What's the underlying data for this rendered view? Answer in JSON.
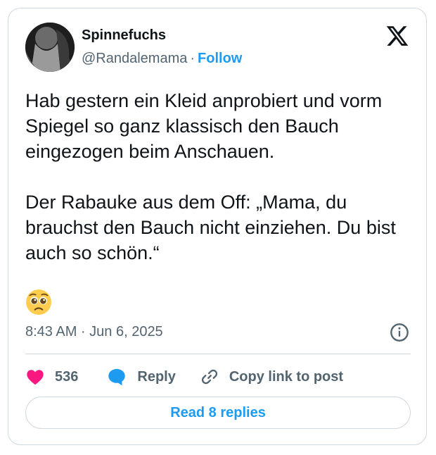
{
  "author": {
    "name": "Spinnefuchs",
    "handle": "@Randalemama",
    "separator": "·",
    "follow_label": "Follow"
  },
  "brand": {
    "logo_icon": "x-logo-icon"
  },
  "post": {
    "paragraphs": [
      "Hab gestern ein Kleid anprobiert und vorm Spiegel so ganz klassisch den Bauch eingezogen beim Anschauen.",
      "Der Rabauke aus dem Off: „Mama, du brauchst den Bauch nicht einziehen. Du bist auch so schön.“"
    ],
    "emoji": "pleading-face-emoji",
    "timestamp": "8:43 AM · Jun 6, 2025"
  },
  "actions": {
    "like_count": "536",
    "reply_label": "Reply",
    "copy_link_label": "Copy link to post"
  },
  "footer": {
    "read_replies_label": "Read 8 replies"
  },
  "colors": {
    "accent": "#1d9bf0",
    "like": "#f91880",
    "text": "#0f1419",
    "muted": "#536471",
    "border": "#cfd9de"
  }
}
